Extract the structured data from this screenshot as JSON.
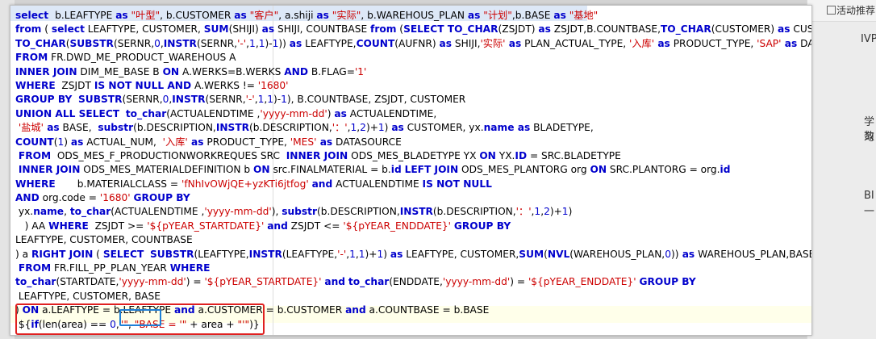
{
  "right_panel": {
    "header": "活动推荐",
    "fragments": [
      "IVP",
      "学习",
      "数",
      "BI",
      "一"
    ]
  },
  "editor": {
    "lines": [
      [
        [
          "kw",
          "select "
        ],
        [
          "t",
          " b.LEAFTYPE "
        ],
        [
          "kw",
          "as"
        ],
        [
          "str",
          " \"叶型\""
        ],
        [
          "t",
          ", b.CUSTOMER "
        ],
        [
          "kw",
          "as"
        ],
        [
          "str",
          " \"客户\""
        ],
        [
          "t",
          ", a.shiji "
        ],
        [
          "kw",
          "as"
        ],
        [
          "str",
          " \"实际\""
        ],
        [
          "t",
          ", b.WAREHOUS_PLAN "
        ],
        [
          "kw",
          "as"
        ],
        [
          "str",
          " \"计划\""
        ],
        [
          "t",
          ",b.BASE "
        ],
        [
          "kw",
          "as"
        ],
        [
          "str",
          " \"基地\""
        ]
      ],
      [
        [
          "kw",
          "from"
        ],
        [
          "t",
          " ( "
        ],
        [
          "kw",
          "select"
        ],
        [
          "t",
          " LEAFTYPE, CUSTOMER, "
        ],
        [
          "kw",
          "SUM"
        ],
        [
          "t",
          "(SHIJI) "
        ],
        [
          "kw",
          "as"
        ],
        [
          "t",
          " SHIJI, COUNTBASE "
        ],
        [
          "kw",
          "from"
        ],
        [
          "t",
          " ("
        ],
        [
          "kw",
          "SELECT TO_CHAR"
        ],
        [
          "t",
          "(ZSJDT) "
        ],
        [
          "kw",
          "as"
        ],
        [
          "t",
          " ZSJDT,B.COUNTBASE,"
        ],
        [
          "kw",
          "TO_CHAR"
        ],
        [
          "t",
          "(CUSTOMER) "
        ],
        [
          "kw",
          "as"
        ],
        [
          "t",
          " CUSTOMER,"
        ]
      ],
      [
        [
          "kw",
          "TO_CHAR"
        ],
        [
          "t",
          "("
        ],
        [
          "kw",
          "SUBSTR"
        ],
        [
          "t",
          "(SERNR,"
        ],
        [
          "num",
          "0"
        ],
        [
          "t",
          ","
        ],
        [
          "kw",
          "INSTR"
        ],
        [
          "t",
          "(SERNR,"
        ],
        [
          "str",
          "'-'"
        ],
        [
          "t",
          ","
        ],
        [
          "num",
          "1"
        ],
        [
          "t",
          ","
        ],
        [
          "num",
          "1"
        ],
        [
          "t",
          ")-"
        ],
        [
          "num",
          "1"
        ],
        [
          "t",
          ")) "
        ],
        [
          "kw",
          "as"
        ],
        [
          "t",
          " LEAFTYPE,"
        ],
        [
          "kw",
          "COUNT"
        ],
        [
          "t",
          "(AUFNR) "
        ],
        [
          "kw",
          "as"
        ],
        [
          "t",
          " SHIJI,"
        ],
        [
          "str",
          "'实际'"
        ],
        [
          "kw",
          " as"
        ],
        [
          "t",
          " PLAN_ACTUAL_TYPE, "
        ],
        [
          "str",
          "'入库'"
        ],
        [
          "kw",
          " as"
        ],
        [
          "t",
          " PRODUCT_TYPE, "
        ],
        [
          "str",
          "'SAP'"
        ],
        [
          "kw",
          " as"
        ],
        [
          "t",
          " DATASOURCE"
        ]
      ],
      [
        [
          "kw",
          "FROM"
        ],
        [
          "t",
          " FR.DWD_ME_PRODUCT_WAREHOUS A"
        ]
      ],
      [
        [
          "kw",
          "INNER JOIN"
        ],
        [
          "t",
          " DIM_ME_BASE B "
        ],
        [
          "kw",
          "ON"
        ],
        [
          "t",
          " A.WERKS=B.WERKS "
        ],
        [
          "kw",
          "AND"
        ],
        [
          "t",
          " B.FLAG="
        ],
        [
          "str",
          "'1'"
        ]
      ],
      [
        [
          "kw",
          "WHERE"
        ],
        [
          "t",
          "  ZSJDT "
        ],
        [
          "kw",
          "IS NOT NULL AND"
        ],
        [
          "t",
          " A.WERKS != "
        ],
        [
          "str",
          "'1680'"
        ]
      ],
      [
        [
          "kw",
          "GROUP BY"
        ],
        [
          "t",
          "  "
        ],
        [
          "kw",
          "SUBSTR"
        ],
        [
          "t",
          "(SERNR,"
        ],
        [
          "num",
          "0"
        ],
        [
          "t",
          ","
        ],
        [
          "kw",
          "INSTR"
        ],
        [
          "t",
          "(SERNR,"
        ],
        [
          "str",
          "'-'"
        ],
        [
          "t",
          ","
        ],
        [
          "num",
          "1"
        ],
        [
          "t",
          ","
        ],
        [
          "num",
          "1"
        ],
        [
          "t",
          ")-"
        ],
        [
          "num",
          "1"
        ],
        [
          "t",
          "), B.COUNTBASE, ZSJDT, CUSTOMER"
        ]
      ],
      [
        [
          "kw",
          "UNION ALL SELECT"
        ],
        [
          "t",
          "  "
        ],
        [
          "kw",
          "to_char"
        ],
        [
          "t",
          "(ACTUALENDTIME ,"
        ],
        [
          "str",
          "'yyyy-mm-dd'"
        ],
        [
          "t",
          ") "
        ],
        [
          "kw",
          "as"
        ],
        [
          "t",
          " ACTUALENDTIME,"
        ]
      ],
      [
        [
          "t",
          " "
        ],
        [
          "str",
          "'盐城'"
        ],
        [
          "kw",
          " as"
        ],
        [
          "t",
          " BASE,  "
        ],
        [
          "kw",
          "substr"
        ],
        [
          "t",
          "(b.DESCRIPTION,"
        ],
        [
          "kw",
          "INSTR"
        ],
        [
          "t",
          "(b.DESCRIPTION,"
        ],
        [
          "str",
          "'：'"
        ],
        [
          "t",
          ","
        ],
        [
          "num",
          "1"
        ],
        [
          "t",
          ","
        ],
        [
          "num",
          "2"
        ],
        [
          "t",
          ")+"
        ],
        [
          "num",
          "1"
        ],
        [
          "t",
          ") "
        ],
        [
          "kw",
          "as"
        ],
        [
          "t",
          " CUSTOMER, yx."
        ],
        [
          "kw",
          "name"
        ],
        [
          "kw",
          " as"
        ],
        [
          "t",
          " BLADETYPE,"
        ]
      ],
      [
        [
          "kw",
          "COUNT"
        ],
        [
          "t",
          "("
        ],
        [
          "num",
          "1"
        ],
        [
          "t",
          ") "
        ],
        [
          "kw",
          "as"
        ],
        [
          "t",
          " ACTUAL_NUM,  "
        ],
        [
          "str",
          "'入库'"
        ],
        [
          "kw",
          " as"
        ],
        [
          "t",
          " PRODUCT_TYPE, "
        ],
        [
          "str",
          "'MES'"
        ],
        [
          "kw",
          " as"
        ],
        [
          "t",
          " DATASOURCE"
        ]
      ],
      [
        [
          "t",
          " "
        ],
        [
          "kw",
          "FROM"
        ],
        [
          "t",
          "  ODS_MES_F_PRODUCTIONWORKREQUES SRC  "
        ],
        [
          "kw",
          "INNER JOIN"
        ],
        [
          "t",
          " ODS_MES_BLADETYPE YX "
        ],
        [
          "kw",
          "ON"
        ],
        [
          "t",
          " YX."
        ],
        [
          "kw",
          "ID"
        ],
        [
          "t",
          " = SRC.BLADETYPE"
        ]
      ],
      [
        [
          "t",
          " "
        ],
        [
          "kw",
          "INNER JOIN"
        ],
        [
          "t",
          " ODS_MES_MATERIALDEFINITION b "
        ],
        [
          "kw",
          "ON"
        ],
        [
          "t",
          " src.FINALMATERIAL = b."
        ],
        [
          "kw",
          "id"
        ],
        [
          "t",
          " "
        ],
        [
          "kw",
          "LEFT JOIN"
        ],
        [
          "t",
          " ODS_MES_PLANTORG org "
        ],
        [
          "kw",
          "ON"
        ],
        [
          "t",
          " SRC.PLANTORG = org."
        ],
        [
          "kw",
          "id"
        ]
      ],
      [
        [
          "kw",
          "WHERE"
        ],
        [
          "t",
          "       b.MATERIALCLASS = "
        ],
        [
          "str",
          "'fNhIvOWjQE+yzKTi6jtfog'"
        ],
        [
          "t",
          " "
        ],
        [
          "kw",
          "and"
        ],
        [
          "t",
          " ACTUALENDTIME "
        ],
        [
          "kw",
          "IS NOT NULL"
        ]
      ],
      [
        [
          "kw",
          "AND"
        ],
        [
          "t",
          " org.code = "
        ],
        [
          "str",
          "'1680'"
        ],
        [
          "t",
          " "
        ],
        [
          "kw",
          "GROUP BY"
        ]
      ],
      [
        [
          "t",
          " yx."
        ],
        [
          "kw",
          "name"
        ],
        [
          "t",
          ", "
        ],
        [
          "kw",
          "to_char"
        ],
        [
          "t",
          "(ACTUALENDTIME ,"
        ],
        [
          "str",
          "'yyyy-mm-dd'"
        ],
        [
          "t",
          "), "
        ],
        [
          "kw",
          "substr"
        ],
        [
          "t",
          "(b.DESCRIPTION,"
        ],
        [
          "kw",
          "INSTR"
        ],
        [
          "t",
          "(b.DESCRIPTION,"
        ],
        [
          "str",
          "'：'"
        ],
        [
          "t",
          ","
        ],
        [
          "num",
          "1"
        ],
        [
          "t",
          ","
        ],
        [
          "num",
          "2"
        ],
        [
          "t",
          ")+"
        ],
        [
          "num",
          "1"
        ],
        [
          "t",
          ")"
        ]
      ],
      [
        [
          "t",
          "   ) AA "
        ],
        [
          "kw",
          "WHERE"
        ],
        [
          "t",
          "  ZSJDT >= "
        ],
        [
          "str",
          "'${pYEAR_STARTDATE}'"
        ],
        [
          "t",
          " "
        ],
        [
          "kw",
          "and"
        ],
        [
          "t",
          " ZSJDT <= "
        ],
        [
          "str",
          "'${pYEAR_ENDDATE}'"
        ],
        [
          "t",
          " "
        ],
        [
          "kw",
          "GROUP BY"
        ]
      ],
      [
        [
          "t",
          "LEAFTYPE, CUSTOMER, COUNTBASE"
        ]
      ],
      [
        [
          "t",
          ") a "
        ],
        [
          "kw",
          "RIGHT JOIN"
        ],
        [
          "t",
          " ( "
        ],
        [
          "kw",
          "SELECT"
        ],
        [
          "t",
          "  "
        ],
        [
          "kw",
          "SUBSTR"
        ],
        [
          "t",
          "(LEAFTYPE,"
        ],
        [
          "kw",
          "INSTR"
        ],
        [
          "t",
          "(LEAFTYPE,"
        ],
        [
          "str",
          "'-'"
        ],
        [
          "t",
          ","
        ],
        [
          "num",
          "1"
        ],
        [
          "t",
          ","
        ],
        [
          "num",
          "1"
        ],
        [
          "t",
          ")+"
        ],
        [
          "num",
          "1"
        ],
        [
          "t",
          ") "
        ],
        [
          "kw",
          "as"
        ],
        [
          "t",
          " LEAFTYPE, CUSTOMER,"
        ],
        [
          "kw",
          "SUM"
        ],
        [
          "t",
          "("
        ],
        [
          "kw",
          "NVL"
        ],
        [
          "t",
          "(WAREHOUS_PLAN,"
        ],
        [
          "num",
          "0"
        ],
        [
          "t",
          "))"
        ],
        [
          "kw",
          " as"
        ],
        [
          "t",
          " WAREHOUS_PLAN,BASE"
        ]
      ],
      [
        [
          "t",
          " "
        ],
        [
          "kw",
          "FROM"
        ],
        [
          "t",
          " FR.FILL_PP_PLAN_YEAR "
        ],
        [
          "kw",
          "WHERE"
        ]
      ],
      [
        [
          "kw",
          "to_char"
        ],
        [
          "t",
          "(STARTDATE,"
        ],
        [
          "str",
          "'yyyy-mm-dd'"
        ],
        [
          "t",
          ") = "
        ],
        [
          "str",
          "'${pYEAR_STARTDATE}'"
        ],
        [
          "t",
          " "
        ],
        [
          "kw",
          "and"
        ],
        [
          "t",
          " "
        ],
        [
          "kw",
          "to_char"
        ],
        [
          "t",
          "(ENDDATE,"
        ],
        [
          "str",
          "'yyyy-mm-dd'"
        ],
        [
          "t",
          ") = "
        ],
        [
          "str",
          "'${pYEAR_ENDDATE}'"
        ],
        [
          "t",
          " "
        ],
        [
          "kw",
          "GROUP BY"
        ]
      ],
      [
        [
          "t",
          " LEAFTYPE, CUSTOMER, BASE"
        ]
      ],
      [
        [
          "t",
          ") "
        ],
        [
          "kw",
          "ON"
        ],
        [
          "t",
          " a.LEAFTYPE = b.LEAFTYPE "
        ],
        [
          "kw",
          "and"
        ],
        [
          "t",
          " a.CUSTOMER = b.CUSTOMER "
        ],
        [
          "kw",
          "and"
        ],
        [
          "t",
          " a.COUNTBASE = b.BASE"
        ]
      ],
      [
        [
          "t",
          " ${"
        ],
        [
          "kw",
          "if"
        ],
        [
          "t",
          "(len(area) == "
        ],
        [
          "num",
          "0"
        ],
        [
          "t",
          ","
        ],
        [
          "str",
          "\"\""
        ],
        [
          "t",
          ", "
        ],
        [
          "str",
          "\"BASE = '\""
        ],
        [
          "t",
          " + area + "
        ],
        [
          "str",
          "\"'\""
        ],
        [
          "t",
          ")}"
        ]
      ]
    ]
  }
}
